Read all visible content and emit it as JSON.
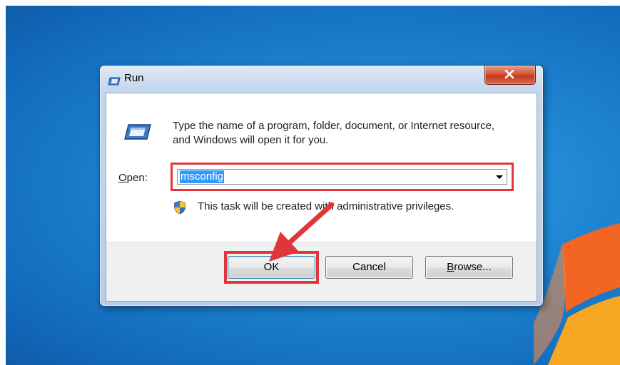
{
  "window": {
    "title": "Run",
    "close_label": "x"
  },
  "content": {
    "description": "Type the name of a program, folder, document, or Internet resource, and Windows will open it for you.",
    "open_label_mnemonic": "O",
    "open_label_rest": "pen:",
    "open_value": "msconfig",
    "admin_note": "This task will be created with administrative privileges."
  },
  "buttons": {
    "ok": "OK",
    "cancel": "Cancel",
    "browse_mnemonic": "B",
    "browse_rest": "rowse..."
  },
  "icons": {
    "title": "run-icon",
    "main": "run-icon",
    "shield": "uac-shield-icon",
    "close": "close-icon",
    "dropdown": "chevron-down-icon"
  },
  "colors": {
    "annotation": "#e0363a",
    "selection": "#3399ff",
    "desktop": "#1f86d3"
  }
}
